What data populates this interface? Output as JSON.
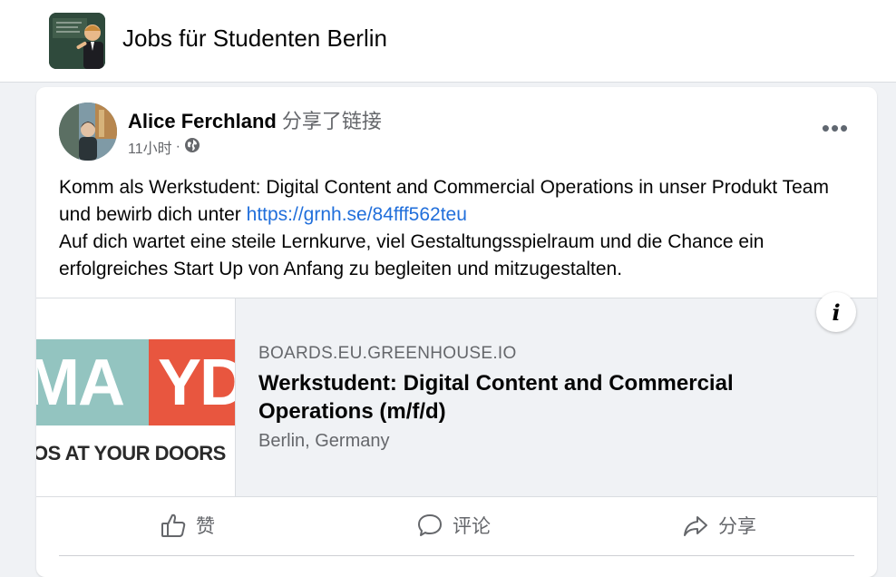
{
  "group": {
    "title": "Jobs für Studenten Berlin",
    "avatar_icon": "group-avatar-image"
  },
  "post": {
    "author_name": "Alice Ferchland",
    "shared_text": "分享了链接",
    "time": "11小时",
    "separator": "·",
    "privacy_icon": "globe-icon",
    "more_label": "•••",
    "text_line1": "Komm als Werkstudent: Digital Content and Commercial Operations in unser Produkt Team und bewirb dich unter ",
    "link_text": "https://grnh.se/84fff562teu",
    "text_line2": "Auf dich wartet eine steile Lernkurve, viel Gestaltungsspielraum und die Chance ein erfolgreiches Start Up von Anfang zu begleiten und mitzugestalten."
  },
  "link_preview": {
    "thumb_text_left": "MA",
    "thumb_text_right": "YD",
    "thumb_tagline": "OS AT YOUR DOORS",
    "domain": "BOARDS.EU.GREENHOUSE.IO",
    "title": "Werkstudent: Digital Content and Commercial Operations (m/f/d)",
    "location": "Berlin, Germany",
    "info_label": "i"
  },
  "actions": {
    "like_label": "赞",
    "comment_label": "评论",
    "share_label": "分享"
  },
  "colors": {
    "link": "#216fdb",
    "secondary_text": "#65676b",
    "thumb_teal": "#93c4c0",
    "thumb_red": "#e8563f"
  }
}
